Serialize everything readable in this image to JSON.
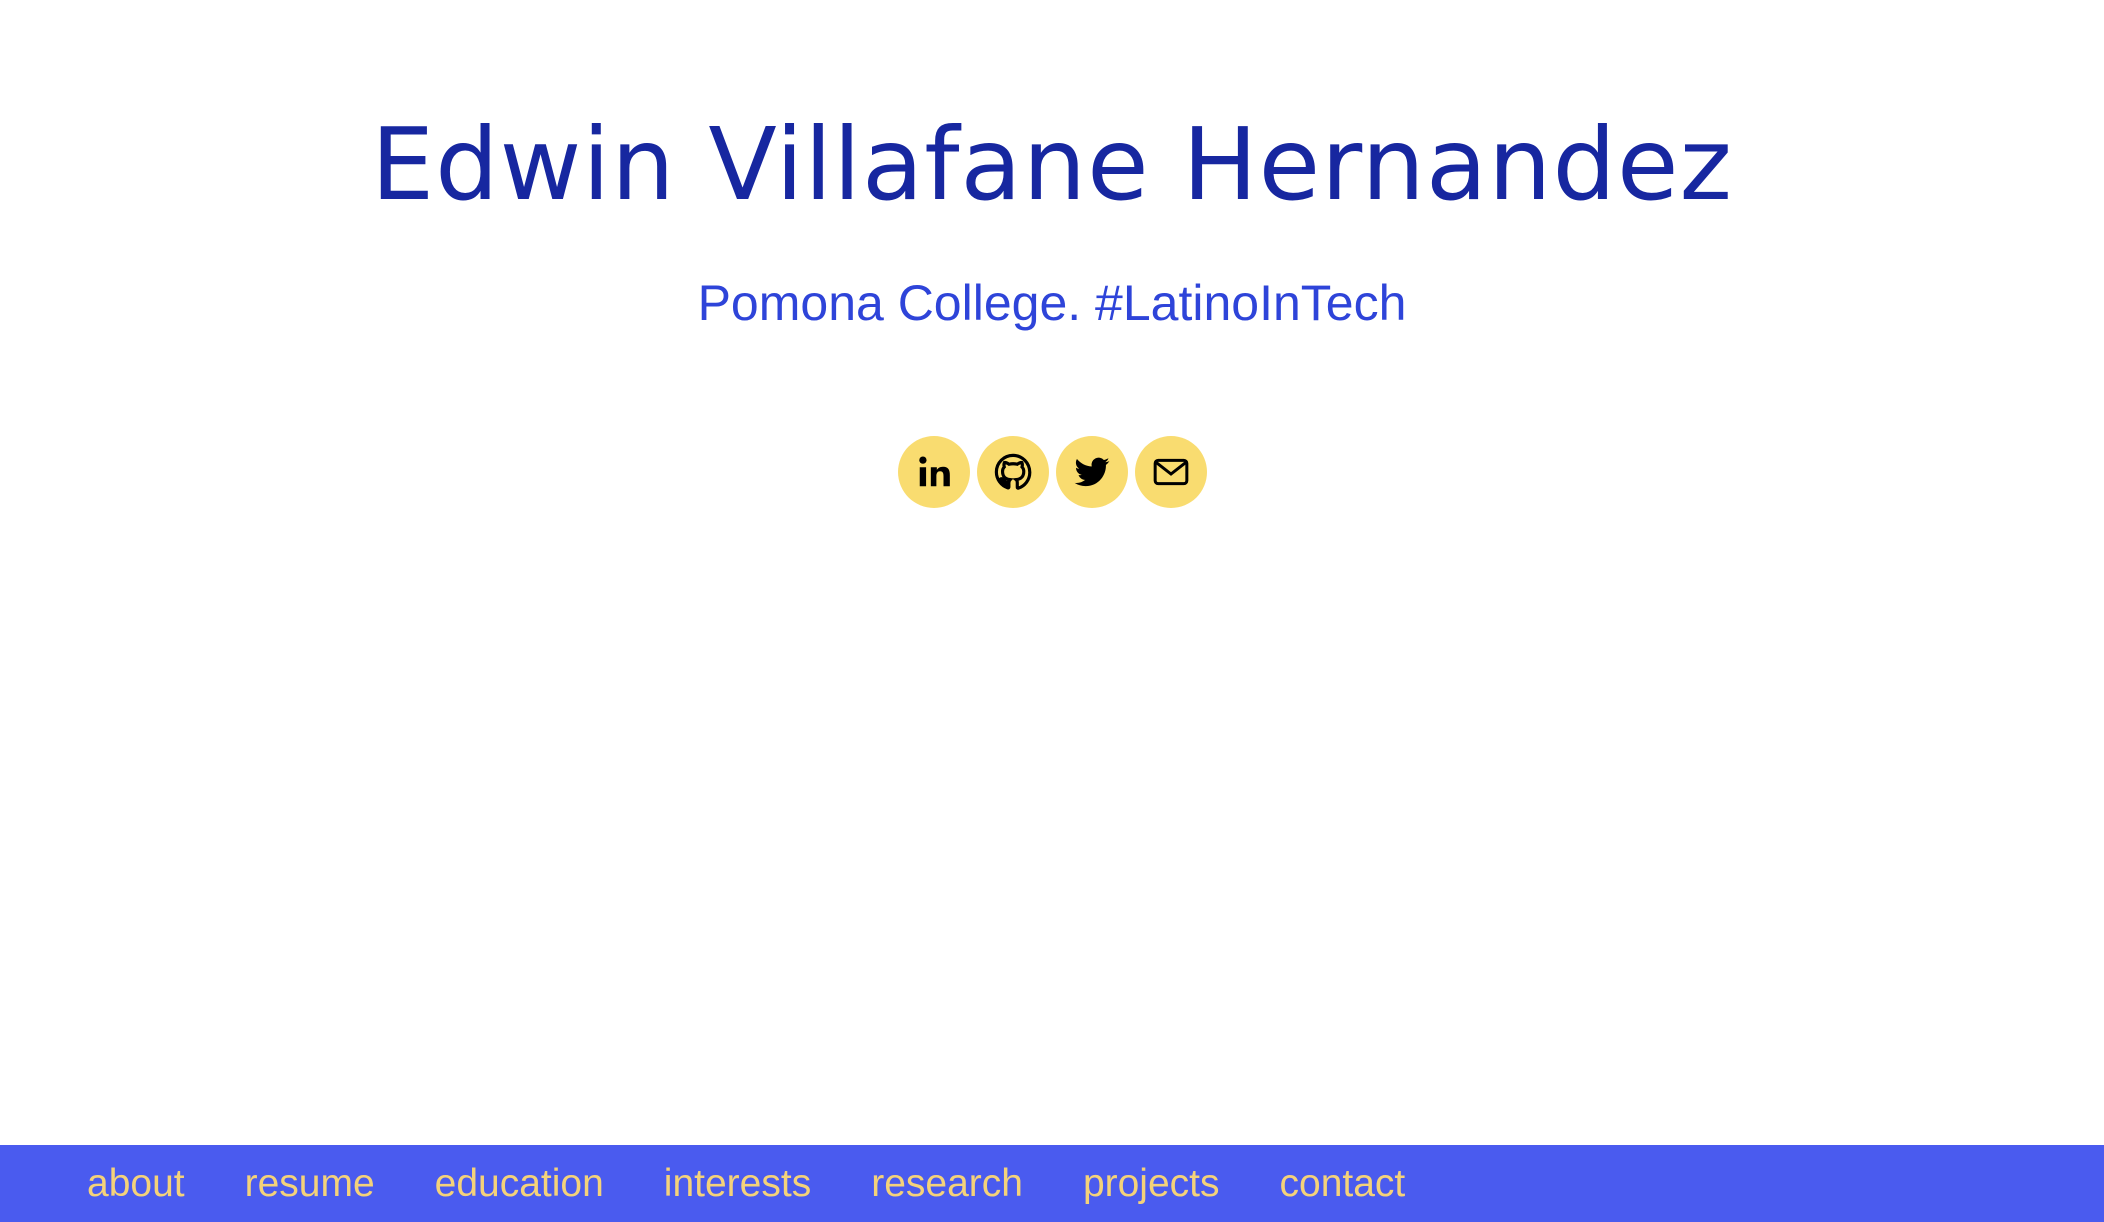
{
  "header": {
    "name": "Edwin Villafane Hernandez",
    "tagline": "Pomona College. #LatinoInTech"
  },
  "social": [
    {
      "icon": "linkedin-icon",
      "label": "LinkedIn"
    },
    {
      "icon": "github-icon",
      "label": "GitHub"
    },
    {
      "icon": "twitter-icon",
      "label": "Twitter"
    },
    {
      "icon": "envelope-icon",
      "label": "Email"
    }
  ],
  "nav": {
    "items": [
      {
        "label": "about"
      },
      {
        "label": "resume"
      },
      {
        "label": "education"
      },
      {
        "label": "interests"
      },
      {
        "label": "research"
      },
      {
        "label": "projects"
      },
      {
        "label": "contact"
      }
    ]
  },
  "colors": {
    "title": "#1727a0",
    "tagline": "#2e44d9",
    "icon_bg": "#f9dc70",
    "navbar_bg": "#4a5bef",
    "nav_text": "#f4d27a"
  }
}
